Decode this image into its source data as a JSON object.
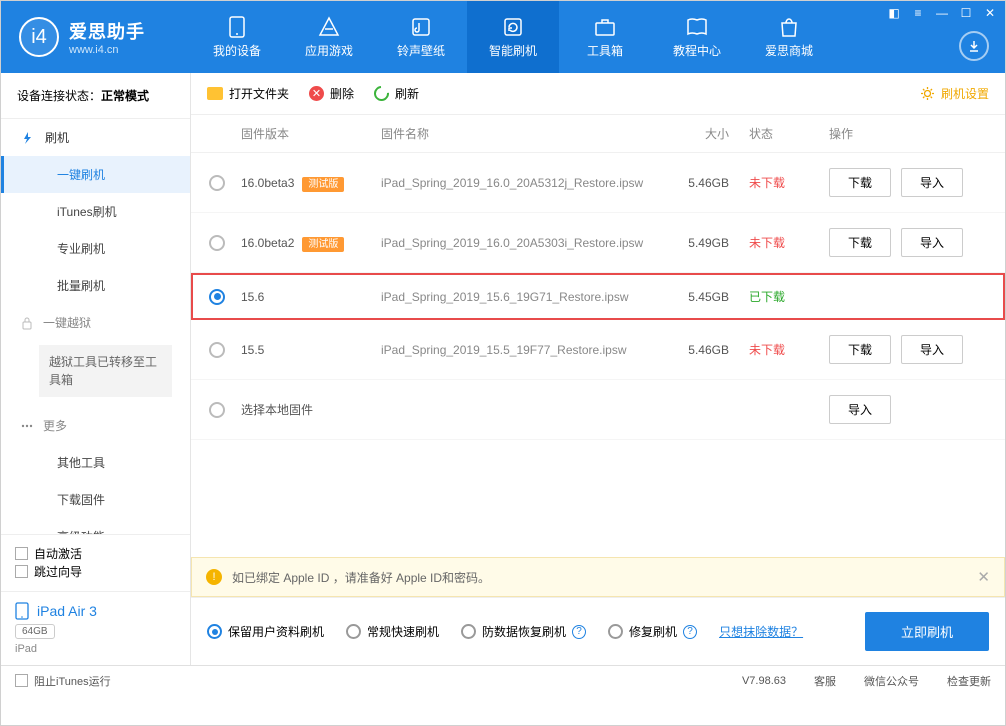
{
  "app": {
    "title": "爱思助手",
    "site": "www.i4.cn"
  },
  "nav": [
    {
      "label": "我的设备"
    },
    {
      "label": "应用游戏"
    },
    {
      "label": "铃声壁纸"
    },
    {
      "label": "智能刷机"
    },
    {
      "label": "工具箱"
    },
    {
      "label": "教程中心"
    },
    {
      "label": "爱思商城"
    }
  ],
  "sidebar": {
    "status_label": "设备连接状态：",
    "status_value": "正常模式",
    "flash_root": "刷机",
    "items": [
      "一键刷机",
      "iTunes刷机",
      "专业刷机",
      "批量刷机"
    ],
    "jailbreak": "一键越狱",
    "jailbreak_note": "越狱工具已转移至工具箱",
    "more": "更多",
    "more_items": [
      "其他工具",
      "下载固件",
      "高级功能"
    ],
    "auto_activate": "自动激活",
    "skip_guide": "跳过向导"
  },
  "device": {
    "name": "iPad Air 3",
    "capacity": "64GB",
    "type": "iPad"
  },
  "toolbar": {
    "open": "打开文件夹",
    "delete": "删除",
    "refresh": "刷新",
    "settings": "刷机设置"
  },
  "columns": {
    "version": "固件版本",
    "name": "固件名称",
    "size": "大小",
    "status": "状态",
    "action": "操作"
  },
  "badge_beta": "测试版",
  "btn_download": "下载",
  "btn_import": "导入",
  "st_no": "未下载",
  "st_ok": "已下载",
  "rows": [
    {
      "ver": "16.0beta3",
      "beta": true,
      "file": "iPad_Spring_2019_16.0_20A5312j_Restore.ipsw",
      "size": "5.46GB",
      "status": "no",
      "selected": false,
      "ops": true
    },
    {
      "ver": "16.0beta2",
      "beta": true,
      "file": "iPad_Spring_2019_16.0_20A5303i_Restore.ipsw",
      "size": "5.49GB",
      "status": "no",
      "selected": false,
      "ops": true
    },
    {
      "ver": "15.6",
      "beta": false,
      "file": "iPad_Spring_2019_15.6_19G71_Restore.ipsw",
      "size": "5.45GB",
      "status": "ok",
      "selected": true,
      "ops": false,
      "highlight": true
    },
    {
      "ver": "15.5",
      "beta": false,
      "file": "iPad_Spring_2019_15.5_19F77_Restore.ipsw",
      "size": "5.46GB",
      "status": "no",
      "selected": false,
      "ops": true
    }
  ],
  "row_local": "选择本地固件",
  "notice": "如已绑定 Apple ID ，请准备好 Apple ID和密码。",
  "options": [
    {
      "label": "保留用户资料刷机",
      "on": true
    },
    {
      "label": "常规快速刷机",
      "on": false
    },
    {
      "label": "防数据恢复刷机",
      "on": false,
      "q": true
    },
    {
      "label": "修复刷机",
      "on": false,
      "q": true
    }
  ],
  "erase_link": "只想抹除数据？",
  "flash_now": "立即刷机",
  "footer": {
    "block_itunes": "阻止iTunes运行",
    "version": "V7.98.63",
    "cs": "客服",
    "wechat": "微信公众号",
    "update": "检查更新"
  }
}
